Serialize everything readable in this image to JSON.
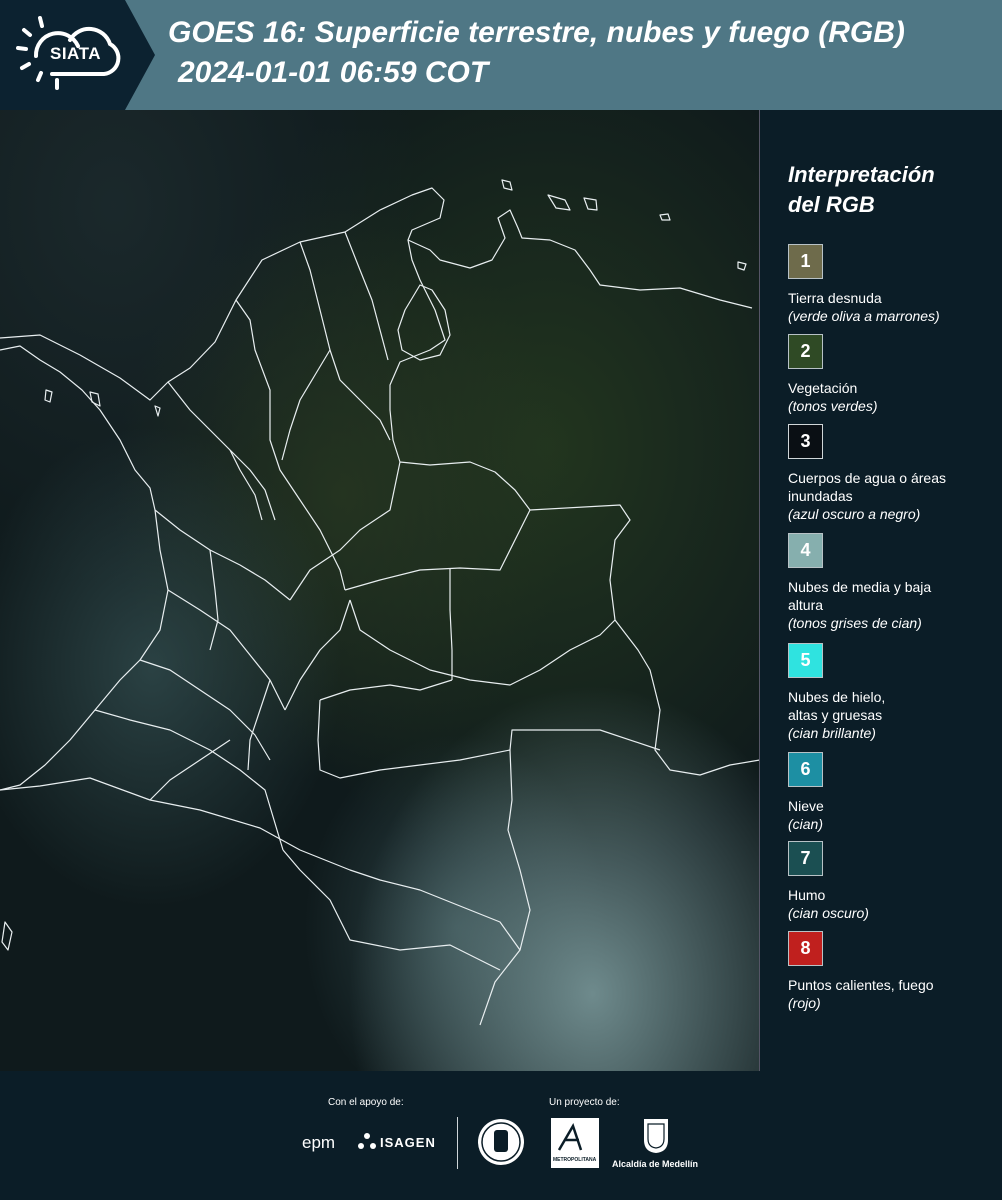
{
  "header": {
    "logo_text": "SIATA",
    "title": "GOES 16: Superficie terrestre, nubes y fuego (RGB)",
    "datetime": "2024-01-01 06:59 COT",
    "band_color": "#4f7785",
    "dark_color": "#0c2230"
  },
  "legend": {
    "title_line1": "Interpretación",
    "title_line2": "del RGB",
    "items": [
      {
        "number": "1",
        "label": "Tierra desnuda",
        "note": "(verde oliva a marrones)",
        "color": "#6e6b4b"
      },
      {
        "number": "2",
        "label": "Vegetación",
        "note": "(tonos verdes)",
        "color": "#2f4a25"
      },
      {
        "number": "3",
        "label": "Cuerpos de agua o áreas inundadas",
        "note": "(azul oscuro a negro)",
        "color": "#0a0f14"
      },
      {
        "number": "4",
        "label": "Nubes de media y baja altura",
        "note": "(tonos grises de cian)",
        "color": "#86afae"
      },
      {
        "number": "5",
        "label": "Nubes de hielo, altas y gruesas",
        "note": "(cian brillante)",
        "color": "#2fe3e0"
      },
      {
        "number": "6",
        "label": "Nieve",
        "note": "(cian)",
        "color": "#1d8fa3"
      },
      {
        "number": "7",
        "label": "Humo",
        "note": "(cian oscuro)",
        "color": "#1b4f52"
      },
      {
        "number": "8",
        "label": "Puntos calientes, fuego",
        "note": "(rojo)",
        "color": "#c0201e"
      }
    ]
  },
  "footer": {
    "support_label": "Con el apoyo de:",
    "project_label": "Un proyecto de:",
    "epm": "epm",
    "isagen": "ISAGEN",
    "area_metropolitana": "METROPOLITANA",
    "alcaldia": "Alcaldía de Medellín"
  }
}
